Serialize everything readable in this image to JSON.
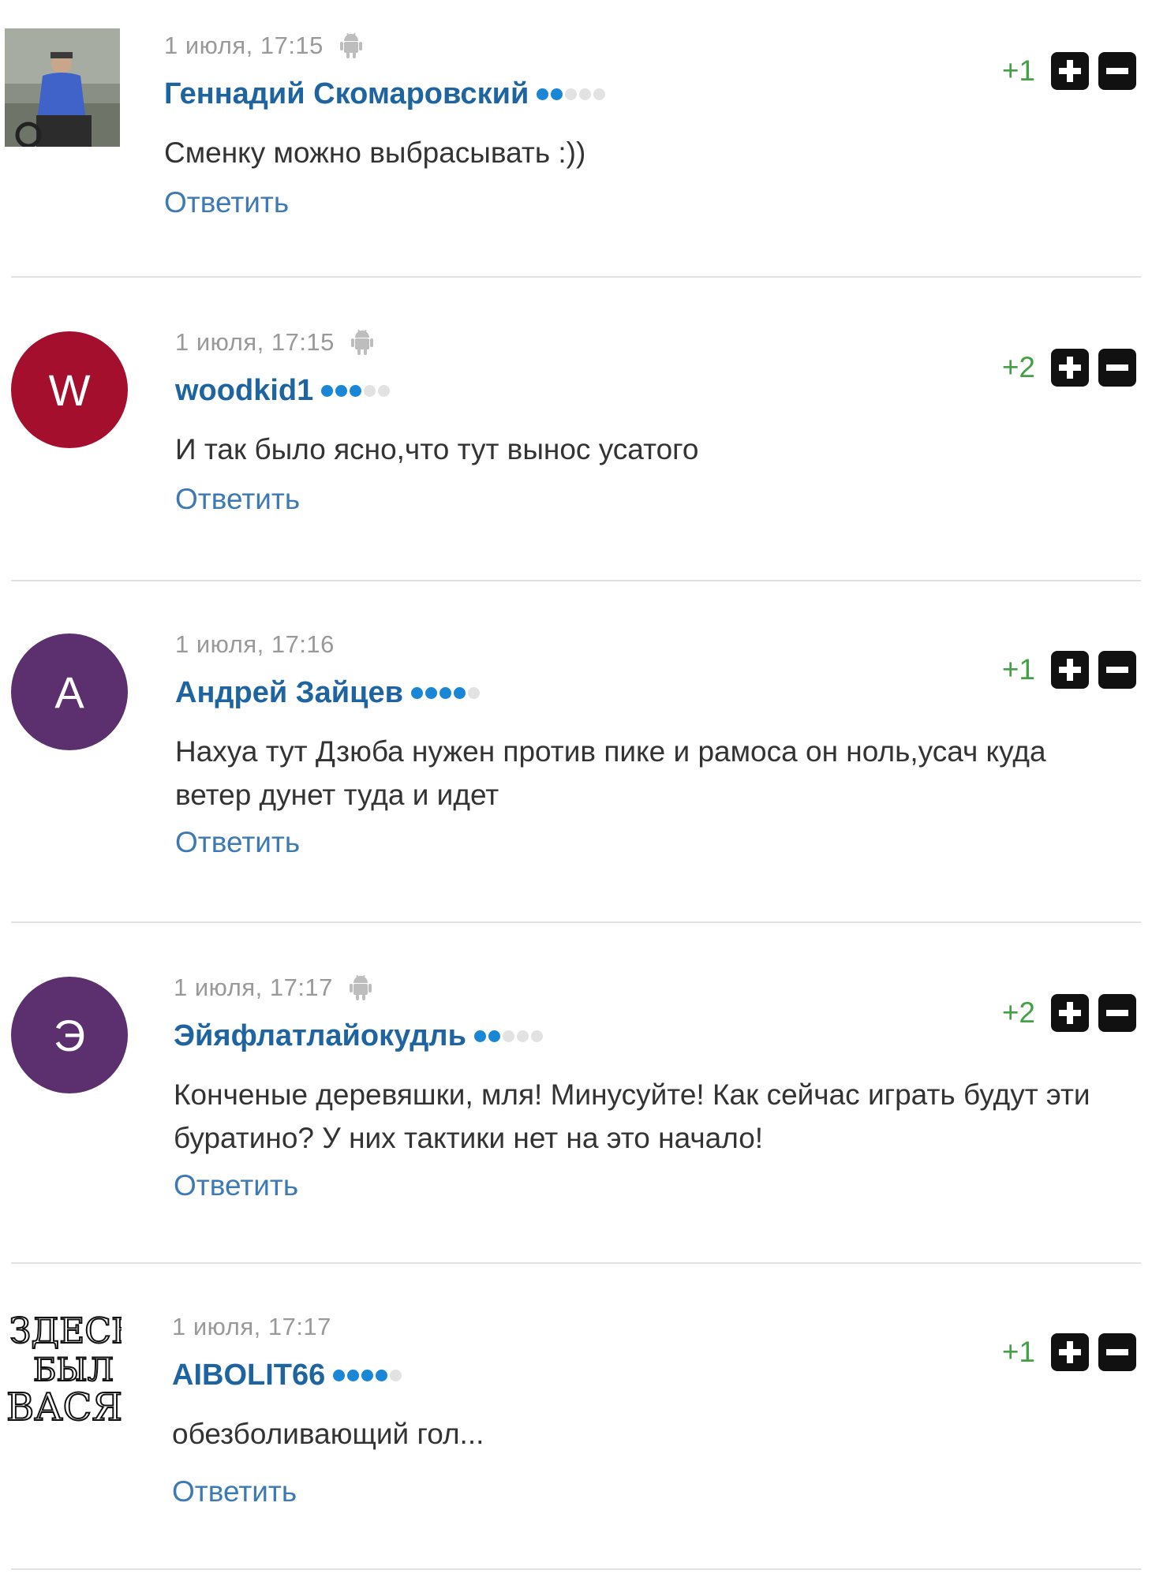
{
  "comments": [
    {
      "date": "1 июля, 17:15",
      "author": "Геннадий Скомаровский",
      "rank_dots": 2,
      "text": "Сменку можно выбрасывать :))",
      "reply": "Ответить",
      "rating": "+1",
      "avatar": {
        "type": "photo"
      },
      "device": "android-icon"
    },
    {
      "date": "1 июля, 17:15",
      "author": "woodkid1",
      "rank_dots": 3,
      "text": "И так было ясно,что тут вынос усатого",
      "reply": "Ответить",
      "rating": "+2",
      "avatar": {
        "type": "letter",
        "letter": "W",
        "color": "#a30f2d"
      },
      "device": "android-icon"
    },
    {
      "date": "1 июля, 17:16",
      "author": "Андрей Зайцев",
      "rank_dots": 4,
      "text": "Нахуа тут Дзюба нужен против пике и рамоса он ноль,усач куда ветер дунет туда и идет",
      "reply": "Ответить",
      "rating": "+1",
      "avatar": {
        "type": "letter",
        "letter": "А",
        "color": "#5c2f6e"
      },
      "device": ""
    },
    {
      "date": "1 июля, 17:17",
      "author": "Эйяфлатлайокудль",
      "rank_dots": 2,
      "text": "Конченые деревяшки, мля! Минусуйте! Как сейчас играть будут эти буратино? У них тактики нет на это начало!",
      "reply": "Ответить",
      "rating": "+2",
      "avatar": {
        "type": "letter",
        "letter": "Э",
        "color": "#5c2f6e"
      },
      "device": "android-icon"
    },
    {
      "date": "1 июля, 17:17",
      "author": "AIBOLIT66",
      "rank_dots": 4,
      "text": "обезболивающий гол...",
      "reply": "Ответить",
      "rating": "+1",
      "avatar": {
        "type": "drawn",
        "lines": [
          "ЗДЕСЬ",
          "БЫЛ",
          "ВАСЯ"
        ]
      },
      "device": ""
    }
  ],
  "colors": {
    "author": "#1e64a0",
    "reply": "#3d7ab5",
    "rating_positive": "#43a047",
    "rank_dot_active": "#1a86d6",
    "rank_dot_inactive": "#e2e2e2"
  }
}
